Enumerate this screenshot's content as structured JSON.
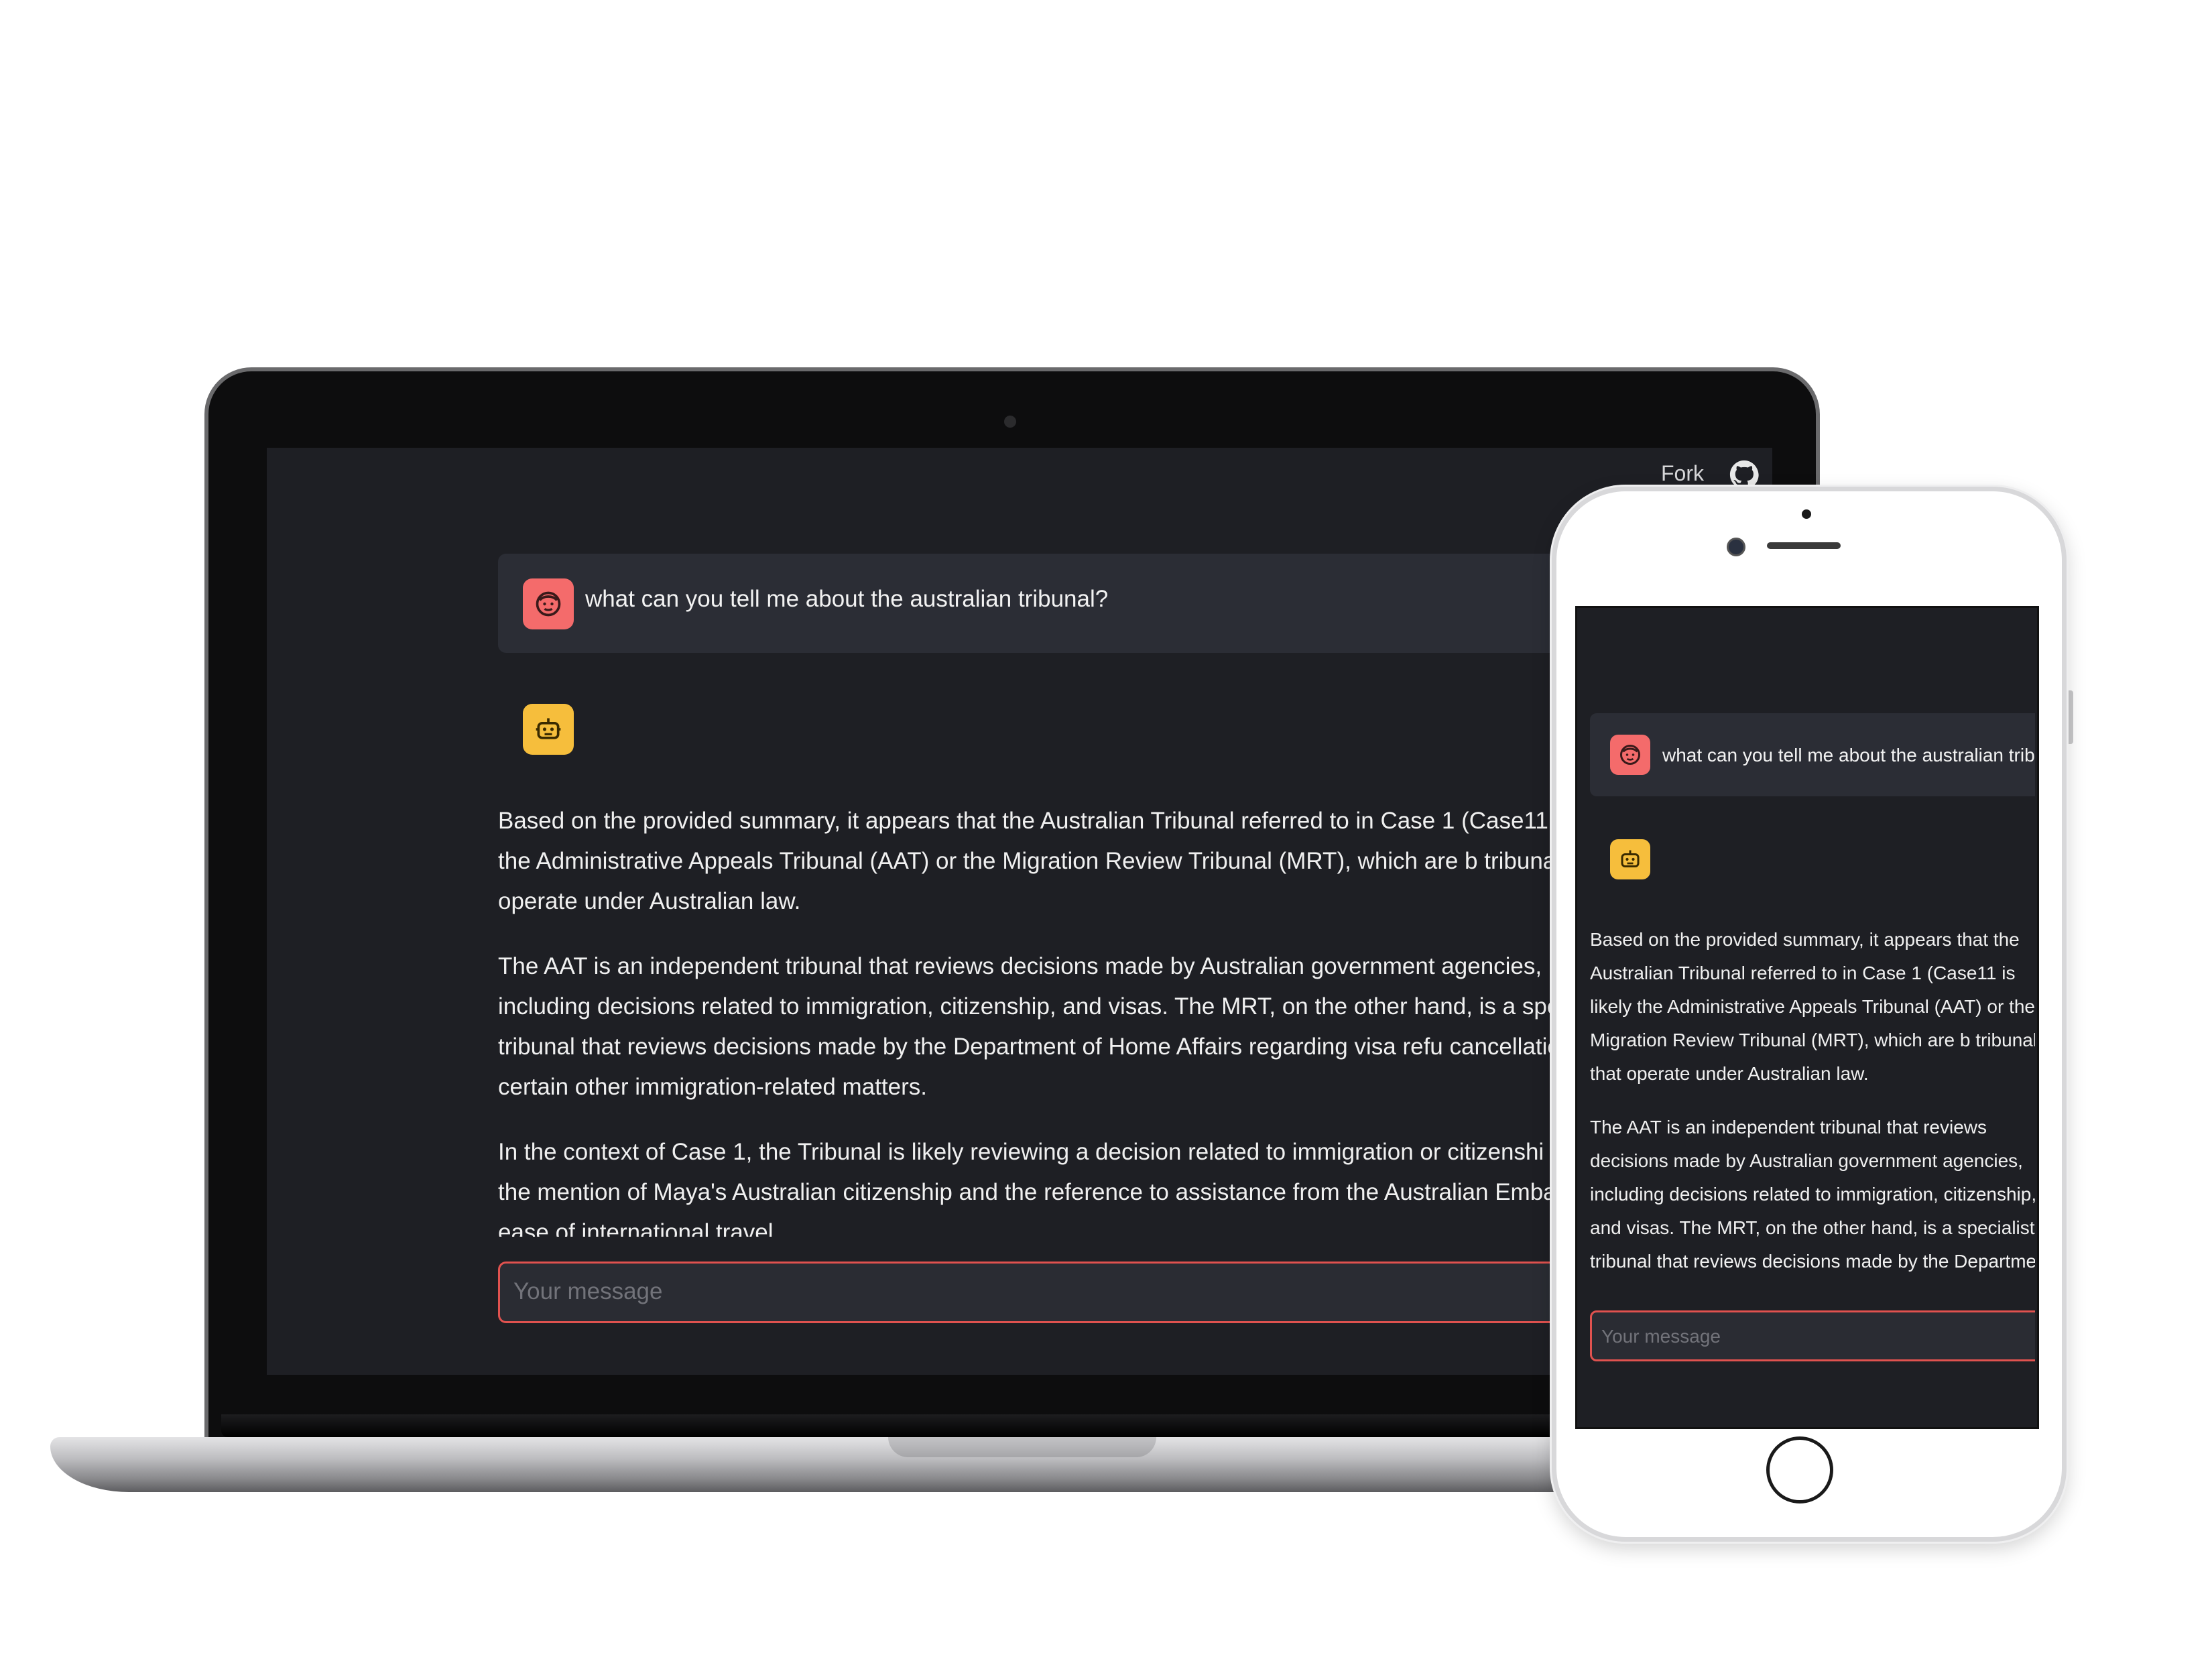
{
  "header": {
    "fork_label": "Fork"
  },
  "chat": {
    "user_message": "what can you tell me about the australian tribunal?",
    "assistant_paragraphs": [
      "Based on the provided summary, it appears that the Australian Tribunal referred to in Case 1 (Case11 is likely the Administrative Appeals Tribunal (AAT) or the Migration Review Tribunal (MRT), which are b tribunals that operate under Australian law.",
      "The AAT is an independent tribunal that reviews decisions made by Australian government agencies, including decisions related to immigration, citizenship, and visas. The MRT, on the other hand, is a specialist tribunal that reviews decisions made by the Department of Home Affairs regarding visa refu cancellations, and certain other immigration-related matters.",
      "In the context of Case 1, the Tribunal is likely reviewing a decision related to immigration or citizenshi given the mention of Maya's Australian citizenship and the reference to assistance from the Australian Embassy and ease of international travel"
    ]
  },
  "input": {
    "placeholder": "Your message"
  },
  "colors": {
    "background": "#1e1f24",
    "user_avatar": "#f46b6b",
    "bot_avatar": "#f6be3c",
    "input_border": "#e0524f"
  },
  "icons": {
    "user_avatar": "user-face-icon",
    "bot_avatar": "robot-icon",
    "github": "github-icon"
  }
}
